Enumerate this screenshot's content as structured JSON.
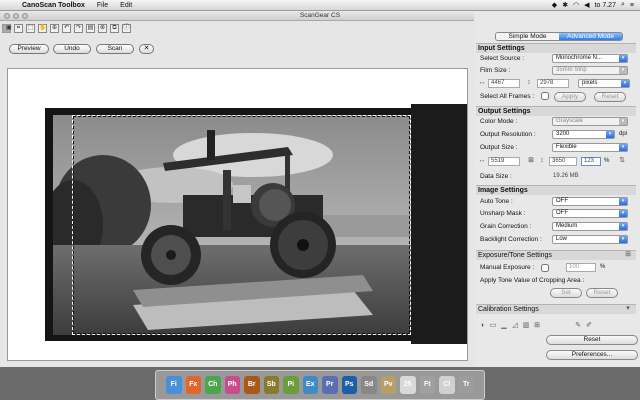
{
  "menubar": {
    "app_name": "CanoScan Toolbox",
    "items": [
      "File",
      "Edit"
    ],
    "status": "to 7.27"
  },
  "window": {
    "title": "ScanGear CS"
  },
  "preview_buttons": {
    "preview": "Preview",
    "undo": "Undo",
    "scan": "Scan"
  },
  "mode_tabs": {
    "simple": "Simple Mode",
    "advanced": "Advanced Mode"
  },
  "input_settings": {
    "header": "Input Settings",
    "select_source_label": "Select Source :",
    "select_source_value": "Monochrome N...",
    "film_size_label": "Film Size :",
    "film_size_value": "35mm Strip",
    "width_value": "4467",
    "height_value": "2978",
    "unit_value": "pixels",
    "select_all_frames": "Select All Frames :",
    "apply": "Apply",
    "reset": "Reset"
  },
  "output_settings": {
    "header": "Output Settings",
    "color_mode_label": "Color Mode :",
    "color_mode_value": "Grayscale",
    "resolution_label": "Output Resolution :",
    "resolution_value": "3200",
    "resolution_unit": "dpi",
    "size_label": "Output Size :",
    "size_value": "Flexible",
    "out_w": "5519",
    "out_h": "3650",
    "scale": "123",
    "scale_unit": "%",
    "data_size_label": "Data Size :",
    "data_size_value": "19.26 MB"
  },
  "image_settings": {
    "header": "Image Settings",
    "auto_tone_label": "Auto Tone :",
    "auto_tone_value": "OFF",
    "unsharp_label": "Unsharp Mask :",
    "unsharp_value": "OFF",
    "grain_label": "Grain Correction :",
    "grain_value": "Medium",
    "backlight_label": "Backlight Correction :",
    "backlight_value": "Low"
  },
  "exposure": {
    "header": "Exposure/Tone Settings",
    "manual_label": "Manual Exposure :",
    "manual_value": "100",
    "manual_unit": "%",
    "apply_crop_label": "Apply Tone Value of Cropping Area :",
    "set": "Set",
    "reset": "Reset"
  },
  "calibration": {
    "header": "Calibration Settings"
  },
  "bottom": {
    "reset": "Reset",
    "preferences": "Preferences..."
  },
  "dock_items": [
    {
      "label": "Fi",
      "color": "#4a8fd8"
    },
    {
      "label": "Fx",
      "color": "#e0662b"
    },
    {
      "label": "Ch",
      "color": "#4ca64c"
    },
    {
      "label": "Ph",
      "color": "#c94d8c"
    },
    {
      "label": "Br",
      "color": "#a8591c"
    },
    {
      "label": "Sb",
      "color": "#8a7a2b"
    },
    {
      "label": "Pi",
      "color": "#6b9e3a"
    },
    {
      "label": "Ex",
      "color": "#3f8cc4"
    },
    {
      "label": "Pr",
      "color": "#5b6fb0"
    },
    {
      "label": "Ps",
      "color": "#1e5da8"
    },
    {
      "label": "Sd",
      "color": "#888888"
    },
    {
      "label": "Pv",
      "color": "#b7a067"
    },
    {
      "label": "25",
      "color": "#d9d9d9"
    },
    {
      "label": "Ft",
      "color": "#a0a0a0"
    },
    {
      "label": "Cl",
      "color": "#d0d0d0"
    },
    {
      "label": "Tr",
      "color": "#9c9c9c"
    }
  ]
}
